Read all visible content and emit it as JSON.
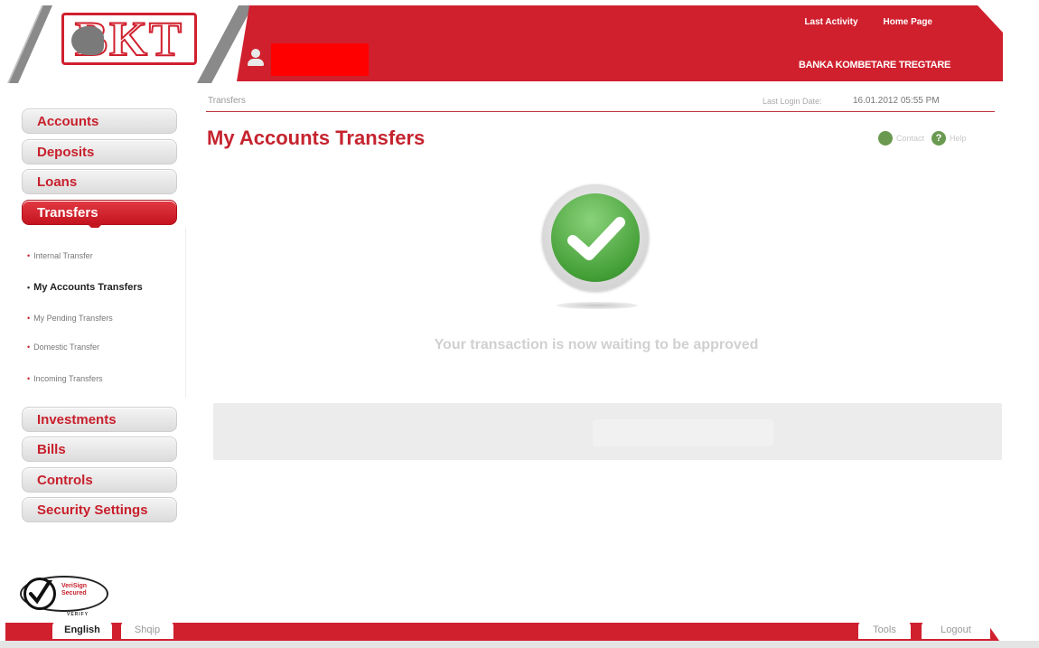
{
  "header": {
    "logo_text": "BKT",
    "top_links": [
      "Last Activity",
      "Home Page"
    ],
    "bank_name": "BANKA KOMBETARE TREGTARE",
    "redaction_color": "#ff0000",
    "brand_color": "#d0202e",
    "user_icon": "user-icon"
  },
  "breadcrumb": {
    "current": "Transfers",
    "last_login_label": "Last Login Date:",
    "last_login_value": "16.01.2012 05:55 PM"
  },
  "page": {
    "title": "My Accounts Transfers",
    "contact_label": "Contact",
    "help_label": "Help",
    "status_message": "Your transaction is now waiting to be approved",
    "status_icon": "check-icon"
  },
  "sidebar": {
    "items": [
      {
        "label": "Accounts"
      },
      {
        "label": "Deposits"
      },
      {
        "label": "Loans"
      },
      {
        "label": "Transfers",
        "active": true
      },
      {
        "label": "Investments"
      },
      {
        "label": "Bills"
      },
      {
        "label": "Controls"
      },
      {
        "label": "Security Settings"
      }
    ],
    "submenu": [
      {
        "label": "Internal Transfer"
      },
      {
        "label": "My Accounts Transfers",
        "current": true
      },
      {
        "label": "My Pending Transfers"
      },
      {
        "label": "Domestic Transfer"
      },
      {
        "label": "Incoming Transfers"
      }
    ]
  },
  "footer": {
    "seal_text": "VeriSign Secured",
    "seal_verify": "VERIFY",
    "language_active": "English",
    "language_other": "Shqip",
    "tools_label": "Tools",
    "logout_label": "Logout"
  }
}
